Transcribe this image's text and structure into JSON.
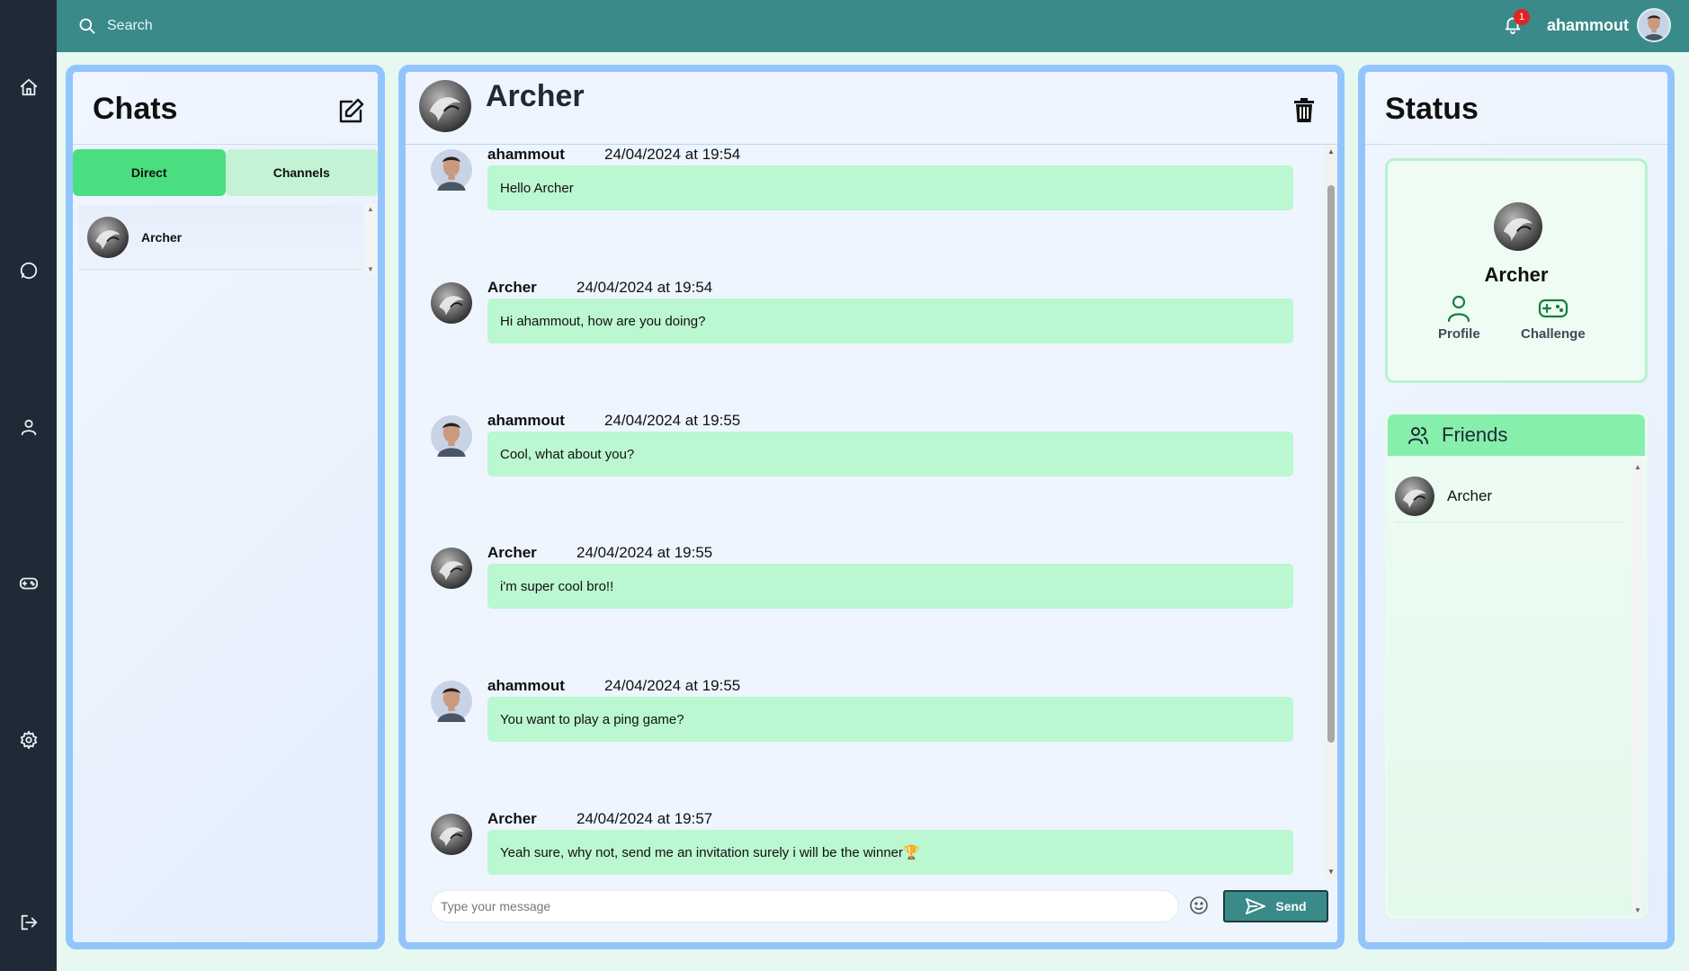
{
  "topbar": {
    "search_placeholder": "Search",
    "notification_count": "1",
    "username": "ahammout"
  },
  "sidebar": {
    "items": [
      {
        "icon": "home-icon"
      },
      {
        "icon": "chat-icon"
      },
      {
        "icon": "user-icon"
      },
      {
        "icon": "gamepad-icon"
      },
      {
        "icon": "gear-icon"
      },
      {
        "icon": "logout-icon"
      }
    ]
  },
  "chats": {
    "title": "Chats",
    "tabs": [
      {
        "label": "Direct",
        "active": true
      },
      {
        "label": "Channels",
        "active": false
      }
    ],
    "items": [
      {
        "name": "Archer"
      }
    ]
  },
  "conversation": {
    "title": "Archer",
    "messages": [
      {
        "author": "ahammout",
        "time": "24/04/2024 at 19:54",
        "text": "Hello Archer"
      },
      {
        "author": "Archer",
        "time": "24/04/2024 at 19:54",
        "text": "Hi ahammout, how are you doing?"
      },
      {
        "author": "ahammout",
        "time": "24/04/2024 at 19:55",
        "text": "Cool, what about you?"
      },
      {
        "author": "Archer",
        "time": "24/04/2024 at 19:55",
        "text": "i'm super cool bro!!"
      },
      {
        "author": "ahammout",
        "time": "24/04/2024 at 19:55",
        "text": "You want to play a ping game?"
      },
      {
        "author": "Archer",
        "time": "24/04/2024 at 19:57",
        "text": "Yeah sure, why not, send me an invitation surely i will be the winner🏆"
      }
    ],
    "input_placeholder": "Type your message",
    "send_label": "Send"
  },
  "status": {
    "title": "Status",
    "name": "Archer",
    "profile_label": "Profile",
    "challenge_label": "Challenge",
    "friends_title": "Friends",
    "friends": [
      {
        "name": "Archer"
      }
    ]
  },
  "colors": {
    "sidebar": "#1f2a36",
    "topbar": "#3a8a8a",
    "panel_border": "#93c5fd",
    "bubble": "#bbf7d0",
    "tab_active": "#4ade80",
    "accent_green": "#15803d"
  }
}
